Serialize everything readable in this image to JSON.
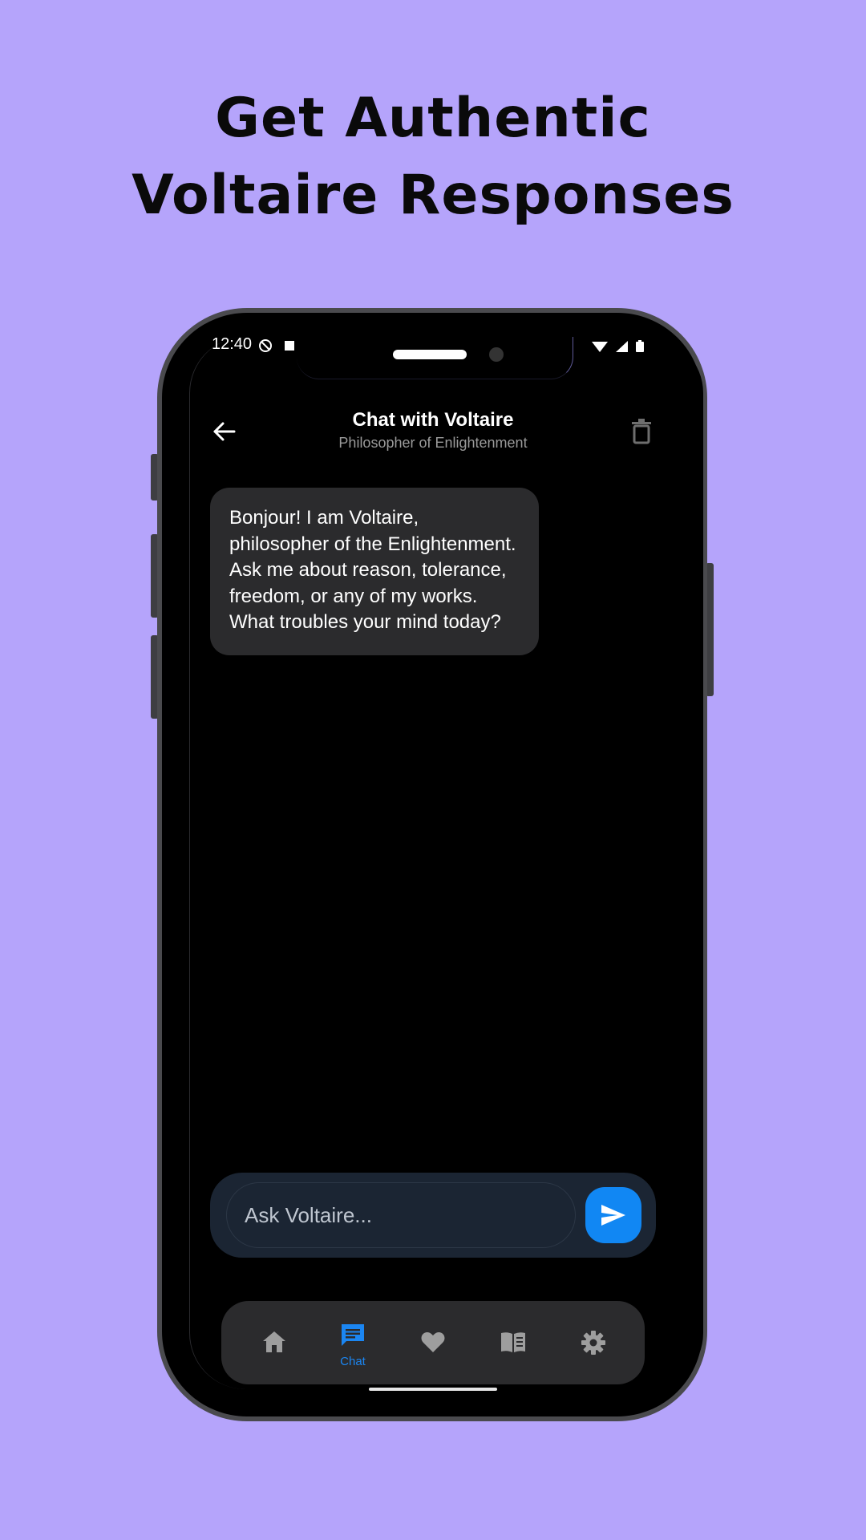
{
  "headline": {
    "line1": "Get Authentic",
    "line2": "Voltaire Responses"
  },
  "status_bar": {
    "time": "12:40"
  },
  "header": {
    "title": "Chat with Voltaire",
    "subtitle": "Philosopher of Enlightenment"
  },
  "messages": [
    {
      "sender": "bot",
      "text": "Bonjour! I am Voltaire, philosopher of the Enlightenment. Ask me about reason, tolerance, freedom, or any of my works. What troubles your mind today?"
    }
  ],
  "composer": {
    "placeholder": "Ask Voltaire..."
  },
  "nav": {
    "items": [
      {
        "icon": "home-icon",
        "label": ""
      },
      {
        "icon": "chat-icon",
        "label": "Chat",
        "active": true
      },
      {
        "icon": "heart-icon",
        "label": ""
      },
      {
        "icon": "book-icon",
        "label": ""
      },
      {
        "icon": "gear-icon",
        "label": ""
      }
    ]
  },
  "colors": {
    "background": "#b5a4fb",
    "accent": "#1187f3",
    "bubble": "#2b2b2d",
    "inactive_icon": "#9e9e9e"
  }
}
